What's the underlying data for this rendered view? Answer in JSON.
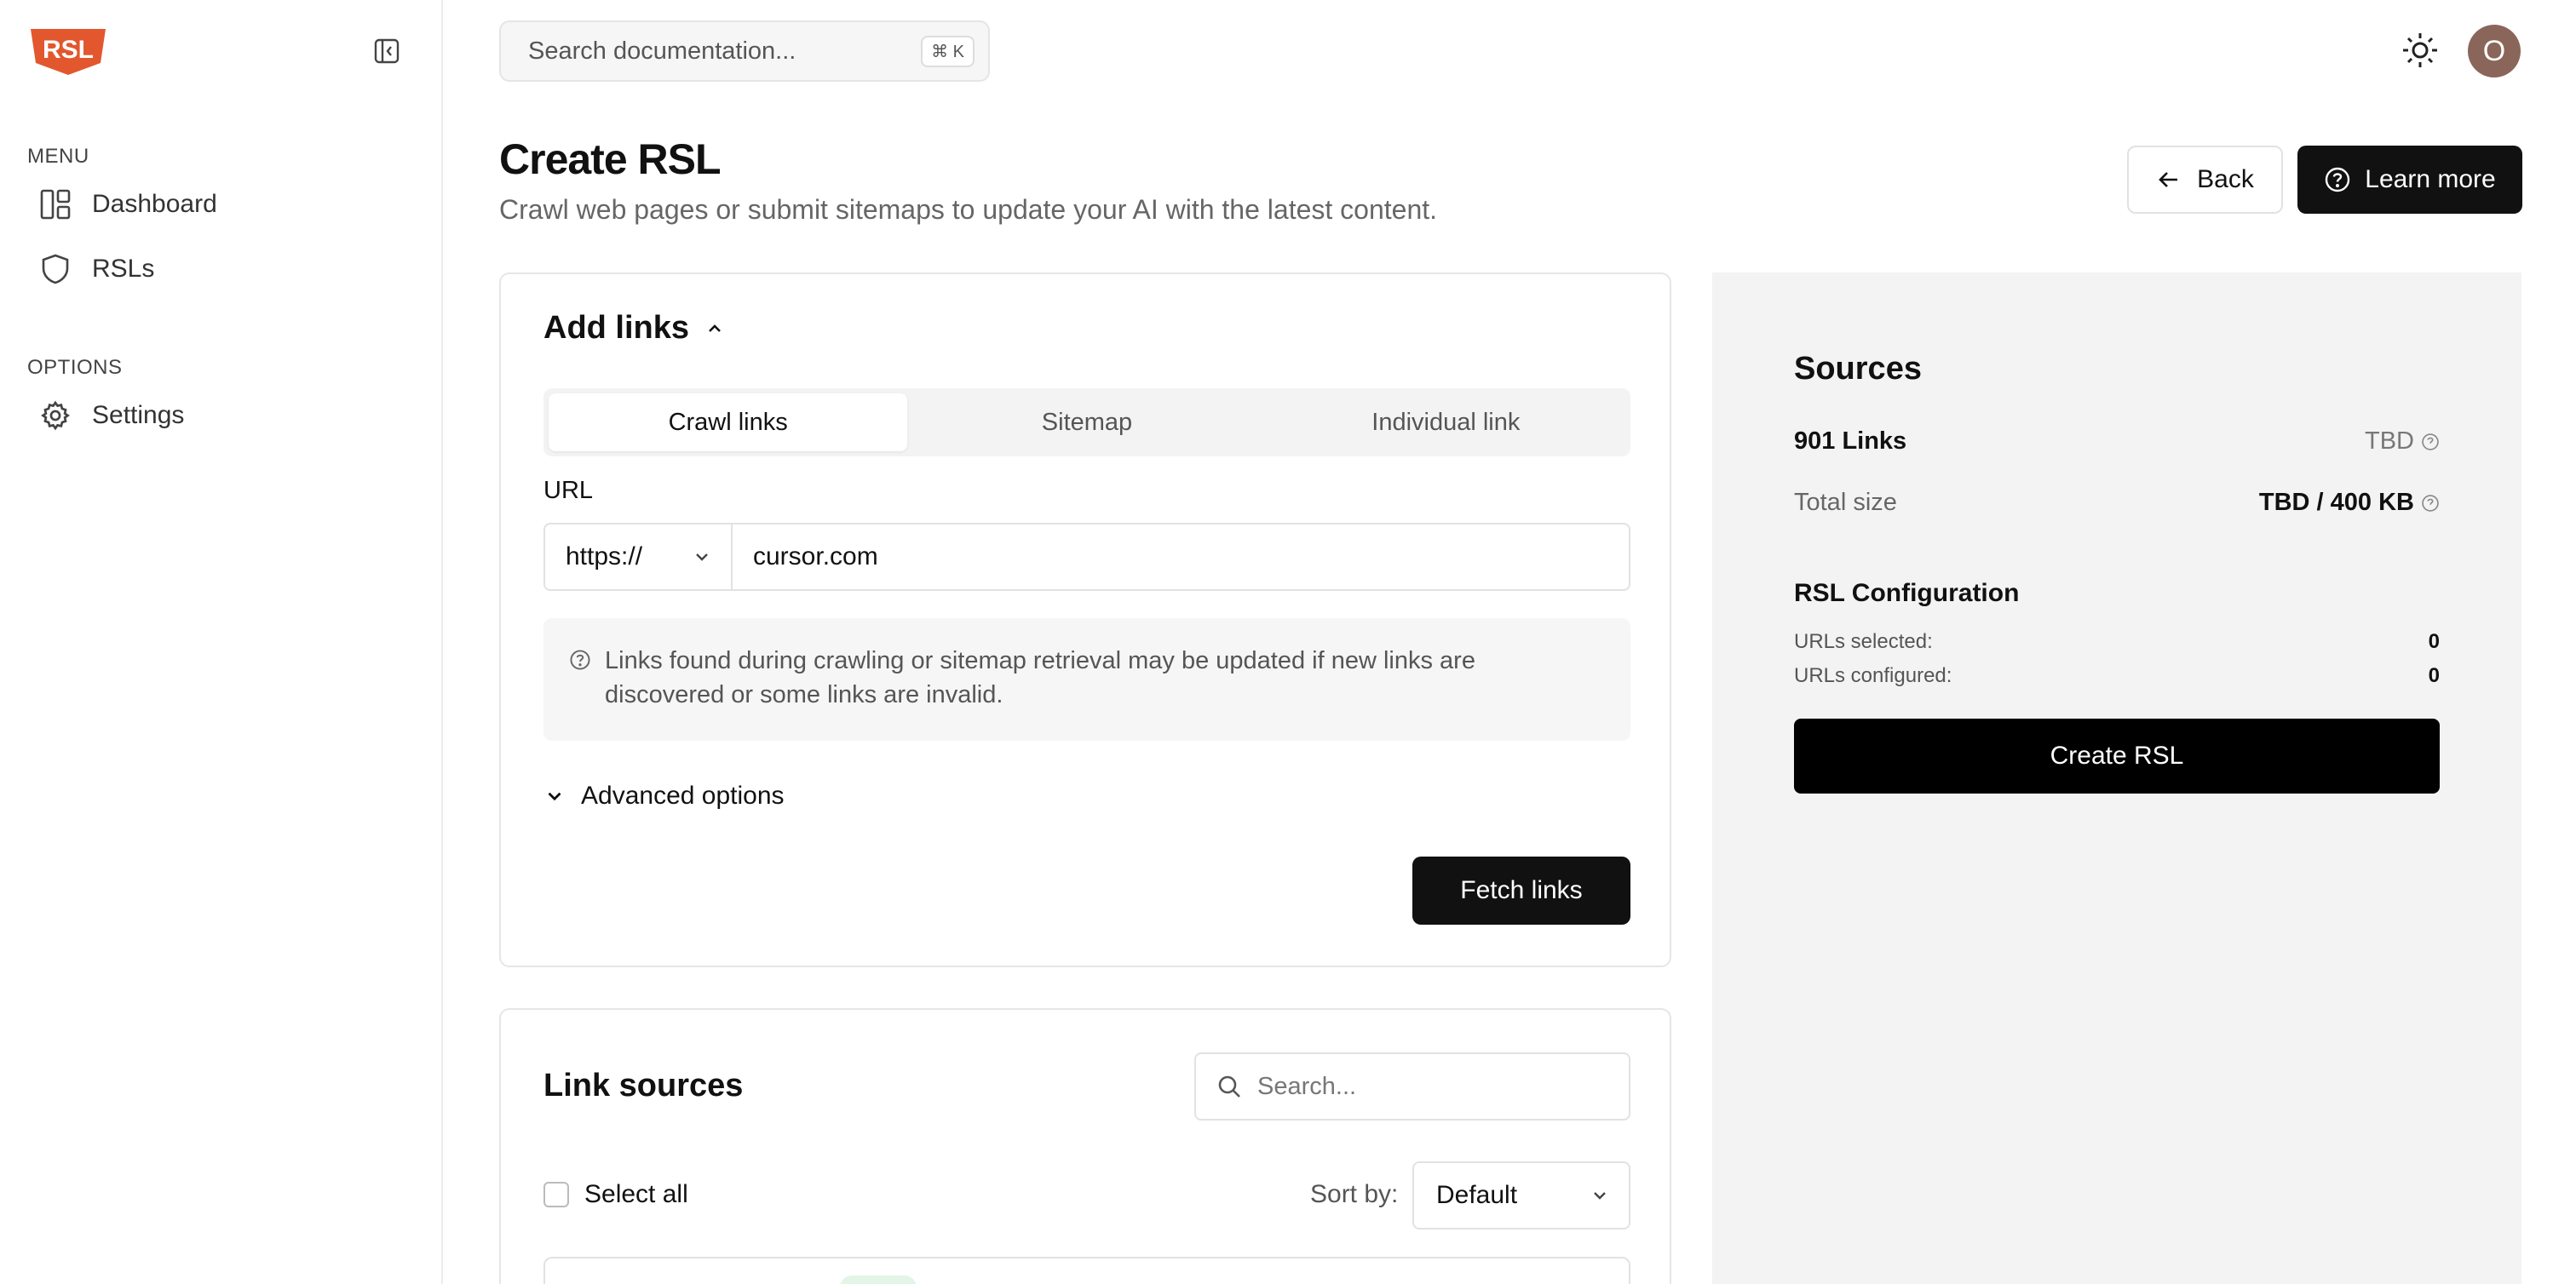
{
  "brand": {
    "logo_text": "RSL",
    "logo_color": "#e2572d",
    "accent": "#111111"
  },
  "sidebar": {
    "sections": [
      {
        "label": "MENU",
        "items": [
          {
            "label": "Dashboard",
            "icon": "dashboard-icon"
          },
          {
            "label": "RSLs",
            "icon": "shield-icon"
          }
        ]
      },
      {
        "label": "OPTIONS",
        "items": [
          {
            "label": "Settings",
            "icon": "gear-icon"
          }
        ]
      }
    ]
  },
  "topbar": {
    "search_placeholder": "Search documentation...",
    "shortcut": "⌘ K",
    "avatar_initial": "O"
  },
  "header": {
    "title": "Create RSL",
    "subtitle": "Crawl web pages or submit sitemaps to update your AI with the latest content.",
    "back_label": "Back",
    "learn_more_label": "Learn more"
  },
  "add_links": {
    "title": "Add links",
    "tabs": [
      {
        "label": "Crawl links",
        "active": true
      },
      {
        "label": "Sitemap",
        "active": false
      },
      {
        "label": "Individual link",
        "active": false
      }
    ],
    "url_label": "URL",
    "protocol": "https://",
    "url_value": "cursor.com",
    "info_text": "Links found during crawling or sitemap retrieval may be updated if new links are discovered or some links are invalid.",
    "advanced_label": "Advanced options",
    "fetch_label": "Fetch links"
  },
  "link_sources": {
    "title": "Link sources",
    "search_placeholder": "Search...",
    "select_all_label": "Select all",
    "sort_label": "Sort by:",
    "sort_value": "Default"
  },
  "sources_panel": {
    "title": "Sources",
    "links_label": "901 Links",
    "links_value": "TBD",
    "size_label": "Total size",
    "size_value": "TBD / 400 KB",
    "config_title": "RSL Configuration",
    "selected_label": "URLs selected:",
    "selected_value": "0",
    "configured_label": "URLs configured:",
    "configured_value": "0",
    "create_label": "Create RSL"
  }
}
